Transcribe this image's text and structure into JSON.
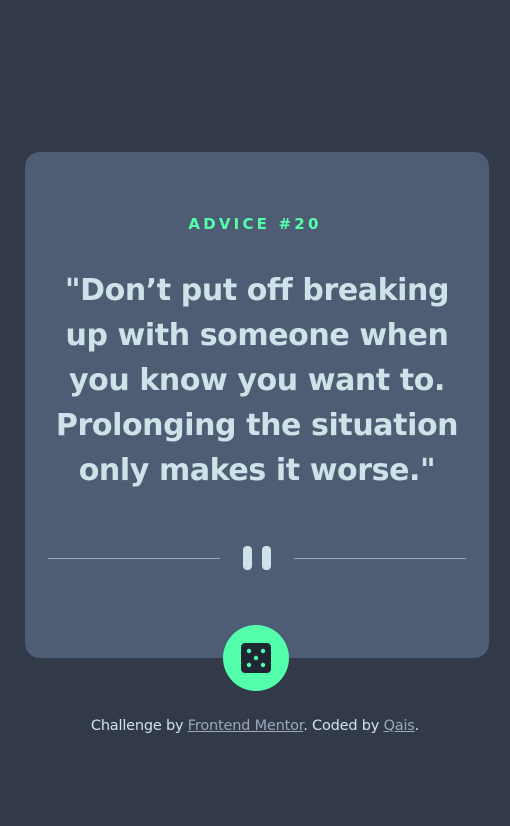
{
  "advice": {
    "id_label": "ADVICE #20",
    "quote": "\"Don’t put off breaking up with someone when you know you want to. Prolonging the situation only makes it worse.\""
  },
  "controls": {
    "divider_icon": "pause-icon",
    "dice_icon": "dice-icon"
  },
  "attribution": {
    "challenge_prefix": "Challenge by ",
    "challenge_link": "Frontend Mentor",
    "coded_prefix": ". Coded by ",
    "coded_link": "Qais",
    "suffix": "."
  },
  "colors": {
    "background": "#323a49",
    "card": "#4e5d73",
    "accent": "#53ffaa",
    "text": "#cee3e9",
    "muted": "#9aa7ba"
  }
}
